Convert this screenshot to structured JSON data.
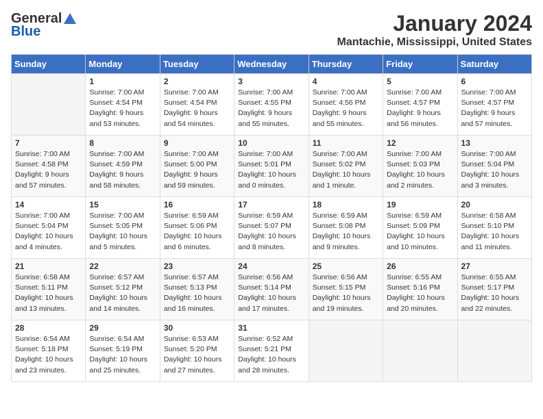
{
  "header": {
    "logo_general": "General",
    "logo_blue": "Blue",
    "month_title": "January 2024",
    "location": "Mantachie, Mississippi, United States"
  },
  "days_of_week": [
    "Sunday",
    "Monday",
    "Tuesday",
    "Wednesday",
    "Thursday",
    "Friday",
    "Saturday"
  ],
  "weeks": [
    [
      {
        "day": "",
        "info": ""
      },
      {
        "day": "1",
        "info": "Sunrise: 7:00 AM\nSunset: 4:54 PM\nDaylight: 9 hours\nand 53 minutes."
      },
      {
        "day": "2",
        "info": "Sunrise: 7:00 AM\nSunset: 4:54 PM\nDaylight: 9 hours\nand 54 minutes."
      },
      {
        "day": "3",
        "info": "Sunrise: 7:00 AM\nSunset: 4:55 PM\nDaylight: 9 hours\nand 55 minutes."
      },
      {
        "day": "4",
        "info": "Sunrise: 7:00 AM\nSunset: 4:56 PM\nDaylight: 9 hours\nand 55 minutes."
      },
      {
        "day": "5",
        "info": "Sunrise: 7:00 AM\nSunset: 4:57 PM\nDaylight: 9 hours\nand 56 minutes."
      },
      {
        "day": "6",
        "info": "Sunrise: 7:00 AM\nSunset: 4:57 PM\nDaylight: 9 hours\nand 57 minutes."
      }
    ],
    [
      {
        "day": "7",
        "info": "Sunrise: 7:00 AM\nSunset: 4:58 PM\nDaylight: 9 hours\nand 57 minutes."
      },
      {
        "day": "8",
        "info": "Sunrise: 7:00 AM\nSunset: 4:59 PM\nDaylight: 9 hours\nand 58 minutes."
      },
      {
        "day": "9",
        "info": "Sunrise: 7:00 AM\nSunset: 5:00 PM\nDaylight: 9 hours\nand 59 minutes."
      },
      {
        "day": "10",
        "info": "Sunrise: 7:00 AM\nSunset: 5:01 PM\nDaylight: 10 hours\nand 0 minutes."
      },
      {
        "day": "11",
        "info": "Sunrise: 7:00 AM\nSunset: 5:02 PM\nDaylight: 10 hours\nand 1 minute."
      },
      {
        "day": "12",
        "info": "Sunrise: 7:00 AM\nSunset: 5:03 PM\nDaylight: 10 hours\nand 2 minutes."
      },
      {
        "day": "13",
        "info": "Sunrise: 7:00 AM\nSunset: 5:04 PM\nDaylight: 10 hours\nand 3 minutes."
      }
    ],
    [
      {
        "day": "14",
        "info": "Sunrise: 7:00 AM\nSunset: 5:04 PM\nDaylight: 10 hours\nand 4 minutes."
      },
      {
        "day": "15",
        "info": "Sunrise: 7:00 AM\nSunset: 5:05 PM\nDaylight: 10 hours\nand 5 minutes."
      },
      {
        "day": "16",
        "info": "Sunrise: 6:59 AM\nSunset: 5:06 PM\nDaylight: 10 hours\nand 6 minutes."
      },
      {
        "day": "17",
        "info": "Sunrise: 6:59 AM\nSunset: 5:07 PM\nDaylight: 10 hours\nand 8 minutes."
      },
      {
        "day": "18",
        "info": "Sunrise: 6:59 AM\nSunset: 5:08 PM\nDaylight: 10 hours\nand 9 minutes."
      },
      {
        "day": "19",
        "info": "Sunrise: 6:59 AM\nSunset: 5:09 PM\nDaylight: 10 hours\nand 10 minutes."
      },
      {
        "day": "20",
        "info": "Sunrise: 6:58 AM\nSunset: 5:10 PM\nDaylight: 10 hours\nand 11 minutes."
      }
    ],
    [
      {
        "day": "21",
        "info": "Sunrise: 6:58 AM\nSunset: 5:11 PM\nDaylight: 10 hours\nand 13 minutes."
      },
      {
        "day": "22",
        "info": "Sunrise: 6:57 AM\nSunset: 5:12 PM\nDaylight: 10 hours\nand 14 minutes."
      },
      {
        "day": "23",
        "info": "Sunrise: 6:57 AM\nSunset: 5:13 PM\nDaylight: 10 hours\nand 16 minutes."
      },
      {
        "day": "24",
        "info": "Sunrise: 6:56 AM\nSunset: 5:14 PM\nDaylight: 10 hours\nand 17 minutes."
      },
      {
        "day": "25",
        "info": "Sunrise: 6:56 AM\nSunset: 5:15 PM\nDaylight: 10 hours\nand 19 minutes."
      },
      {
        "day": "26",
        "info": "Sunrise: 6:55 AM\nSunset: 5:16 PM\nDaylight: 10 hours\nand 20 minutes."
      },
      {
        "day": "27",
        "info": "Sunrise: 6:55 AM\nSunset: 5:17 PM\nDaylight: 10 hours\nand 22 minutes."
      }
    ],
    [
      {
        "day": "28",
        "info": "Sunrise: 6:54 AM\nSunset: 5:18 PM\nDaylight: 10 hours\nand 23 minutes."
      },
      {
        "day": "29",
        "info": "Sunrise: 6:54 AM\nSunset: 5:19 PM\nDaylight: 10 hours\nand 25 minutes."
      },
      {
        "day": "30",
        "info": "Sunrise: 6:53 AM\nSunset: 5:20 PM\nDaylight: 10 hours\nand 27 minutes."
      },
      {
        "day": "31",
        "info": "Sunrise: 6:52 AM\nSunset: 5:21 PM\nDaylight: 10 hours\nand 28 minutes."
      },
      {
        "day": "",
        "info": ""
      },
      {
        "day": "",
        "info": ""
      },
      {
        "day": "",
        "info": ""
      }
    ]
  ]
}
